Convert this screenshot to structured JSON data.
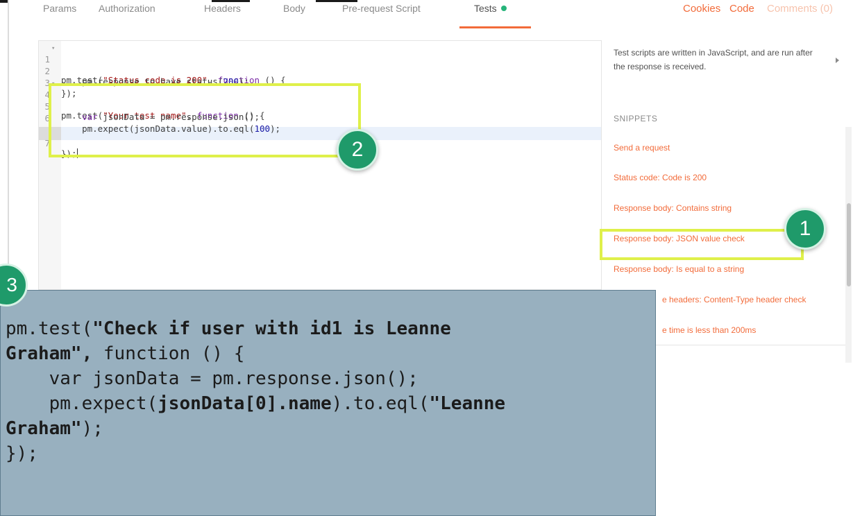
{
  "tabs": [
    {
      "label": "Params"
    },
    {
      "label": "Authorization"
    },
    {
      "label": "Headers"
    },
    {
      "label": "Body"
    },
    {
      "label": "Pre-request Script"
    },
    {
      "label": "Tests"
    }
  ],
  "right_links": {
    "cookies": "Cookies",
    "code": "Code",
    "comments": "Comments (0)"
  },
  "editor": {
    "lines": [
      {
        "num": "1",
        "folded": true
      },
      {
        "num": "2",
        "folded": false
      },
      {
        "num": "3",
        "folded": false
      },
      {
        "num": "4",
        "folded": true
      },
      {
        "num": "5",
        "folded": false
      },
      {
        "num": "6",
        "folded": false
      },
      {
        "num": "7",
        "folded": false
      }
    ],
    "fold_glyph": "▾",
    "code": {
      "l1_a": "pm.test(",
      "l1_str": "\"Status code is 200\"",
      "l1_b": ", ",
      "l1_kw": "function",
      "l1_c": " () {",
      "l2_a": "    pm.response.to.have.status(",
      "l2_num": "200",
      "l2_b": ");",
      "l3": "});",
      "l4_a": "pm.test(",
      "l4_str": "\"Your test name\"",
      "l4_b": ", ",
      "l4_kw": "function",
      "l4_c": " () {",
      "l5_kw": "    var",
      "l5_a": " jsonData = pm.response.json();",
      "l6_a": "    pm.expect(jsonData.value).to.eql(",
      "l6_num": "100",
      "l6_b": ");",
      "l7": "});"
    }
  },
  "snippets": {
    "help_text": "Test scripts are written in JavaScript, and are run after the response is received.",
    "heading": "SNIPPETS",
    "items": [
      {
        "label": "Send a request"
      },
      {
        "label": "Status code: Code is 200"
      },
      {
        "label": "Response body: Contains string"
      },
      {
        "label": "Response body: JSON value check"
      },
      {
        "label": "Response body: Is equal to a string"
      },
      {
        "label": "e headers: Content-Type header check"
      },
      {
        "label": "e time is less than 200ms"
      }
    ]
  },
  "badges": {
    "one": "1",
    "two": "2",
    "three": "3"
  },
  "overlay": {
    "l1_a": "pm.test(",
    "l1_b": "\"Check if user with id1 is Leanne",
    "l2_b": "Graham\",",
    "l2_a": " function () {",
    "l3": "    var jsonData = pm.response.json();",
    "l4_a": "    pm.expect(",
    "l4_b": "jsonData[0].name",
    "l4_c": ").to.eql(",
    "l4_d": "\"Leanne",
    "l5_b": "Graham\"",
    "l5_a": ");",
    "l6": "});"
  },
  "colors": {
    "accent": "#f26b3a",
    "highlight": "#dff04a",
    "badge": "#1f9a6a",
    "overlay_bg": "#98b0bf"
  }
}
